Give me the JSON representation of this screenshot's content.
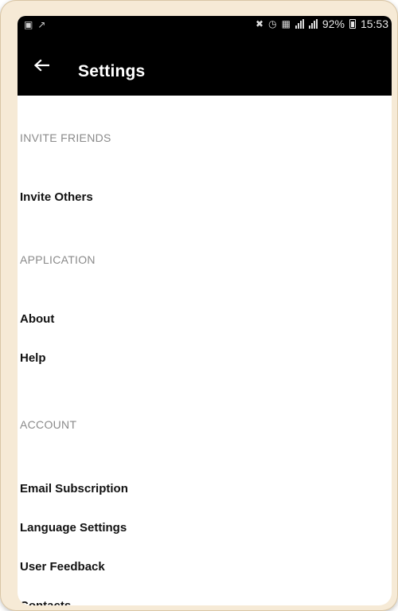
{
  "status_bar": {
    "battery_percent": "92%",
    "time": "15:53"
  },
  "app_bar": {
    "title": "Settings",
    "back_icon": "arrow-left-icon"
  },
  "sections": [
    {
      "header": "INVITE FRIENDS",
      "items": [
        "Invite Others"
      ]
    },
    {
      "header": "APPLICATION",
      "items": [
        "About",
        "Help"
      ]
    },
    {
      "header": "ACCOUNT",
      "items": [
        "Email Subscription",
        "Language Settings",
        "User Feedback",
        "Contacts"
      ]
    }
  ],
  "colors": {
    "app_bar_background": "#000000",
    "section_header_text": "#8a8a8a",
    "item_text": "#111111"
  }
}
